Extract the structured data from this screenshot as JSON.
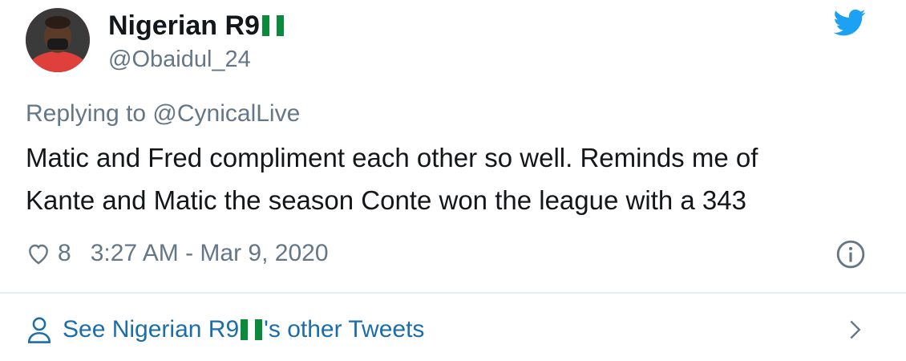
{
  "author": {
    "display_name": "Nigerian R9",
    "handle": "@Obaidul_24",
    "flag_icon": "nigeria-flag-icon"
  },
  "tweet": {
    "replying_to": "Replying to @CynicalLive",
    "text_line1": "Matic and Fred compliment each other so well. Reminds me of",
    "text_line2": "Kante and Matic the season Conte won the league with a 343",
    "likes": "8",
    "timestamp": "3:27 AM - Mar 9, 2020"
  },
  "footer": {
    "prefix": "See Nigerian R9",
    "suffix": "'s other Tweets"
  },
  "colors": {
    "twitter_blue": "#1da1f2",
    "link_blue": "#1b6eaa",
    "muted_gray": "#657786",
    "flag_green": "#0a8a3a"
  }
}
